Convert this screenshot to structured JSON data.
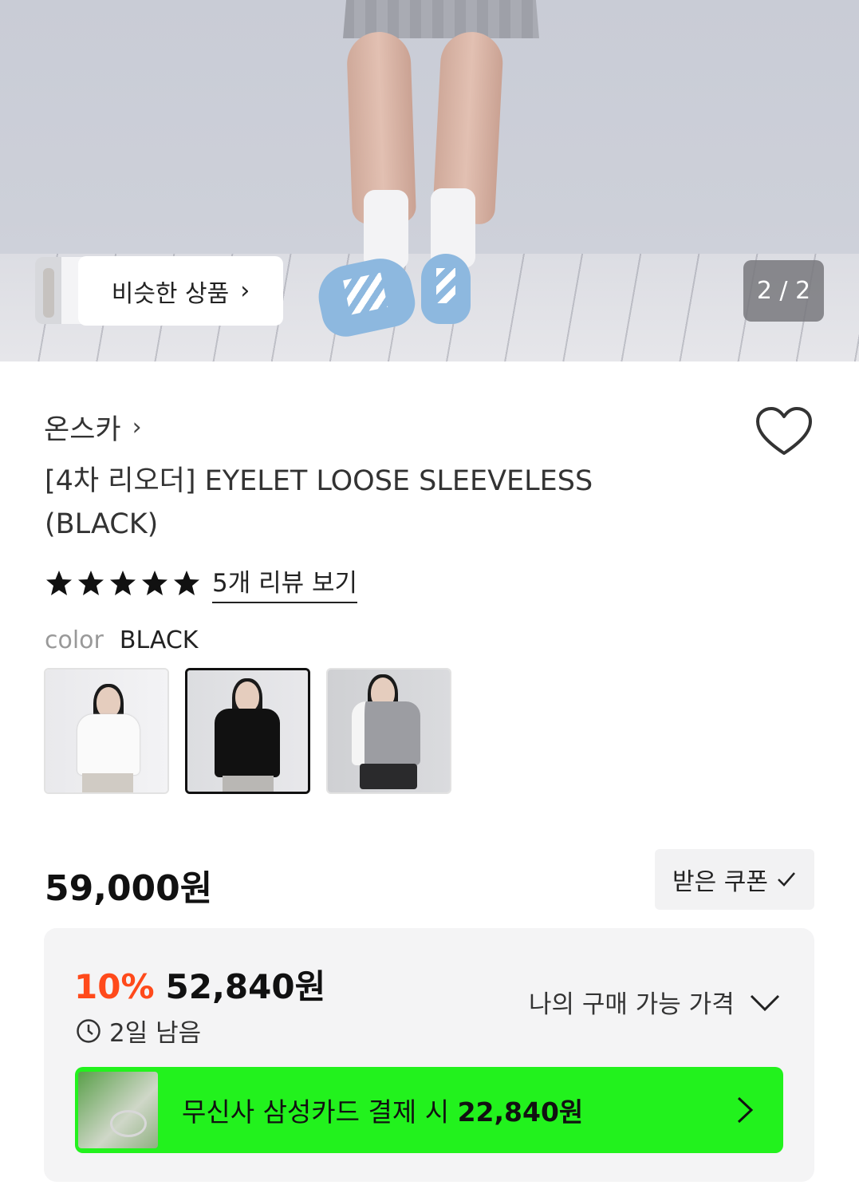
{
  "gallery": {
    "similar_label": "비슷한 상품",
    "page_counter": "2 / 2"
  },
  "product": {
    "brand": "온스카",
    "title_line1": "[4차 리오더] EYELET LOOSE SLEEVELESS",
    "title_line2": "(BLACK)",
    "rating_stars": 5,
    "review_link": "5개 리뷰 보기",
    "color_label": "color",
    "color_value": "BLACK",
    "swatches": [
      {
        "color": "white",
        "selected": false
      },
      {
        "color": "black",
        "selected": true
      },
      {
        "color": "gray",
        "selected": false
      }
    ]
  },
  "price": {
    "original": "59,000원",
    "coupon_button": "받은 쿠폰",
    "discount_rate": "10%",
    "discount_price": "52,840원",
    "countdown": "2일 남음",
    "my_price_label": "나의 구매 가능 가격",
    "card_promo_prefix": "무신사 삼성카드 결제 시 ",
    "card_promo_price": "22,840원"
  },
  "colors": {
    "discount": "#ff4a1b",
    "card_banner": "#22f21d"
  }
}
